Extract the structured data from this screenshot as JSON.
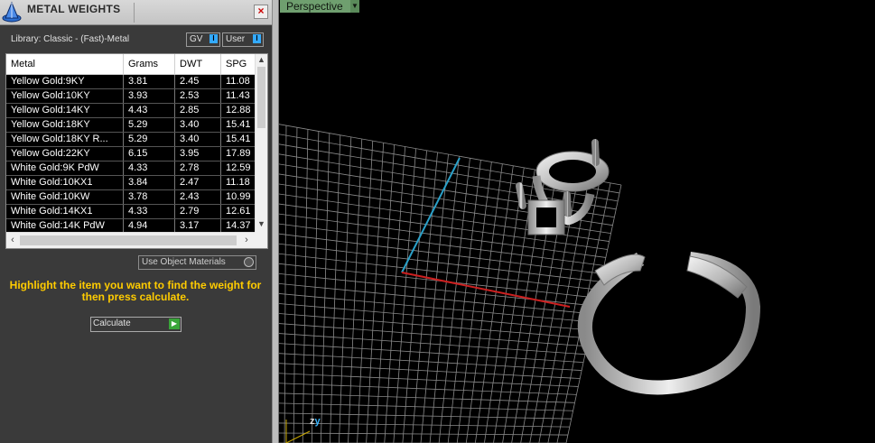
{
  "panel": {
    "title": "METAL WEIGHTS",
    "library": "Library: Classic - (Fast)-Metal",
    "toggles": {
      "gv": "GV",
      "user": "User"
    },
    "table": {
      "headers": [
        "Metal",
        "Grams",
        "DWT",
        "SPG"
      ],
      "rows": [
        [
          "Yellow Gold:9KY",
          "3.81",
          "2.45",
          "11.08"
        ],
        [
          "Yellow Gold:10KY",
          "3.93",
          "2.53",
          "11.43"
        ],
        [
          "Yellow Gold:14KY",
          "4.43",
          "2.85",
          "12.88"
        ],
        [
          "Yellow Gold:18KY",
          "5.29",
          "3.40",
          "15.41"
        ],
        [
          "Yellow Gold:18KY R...",
          "5.29",
          "3.40",
          "15.41"
        ],
        [
          "Yellow Gold:22KY",
          "6.15",
          "3.95",
          "17.89"
        ],
        [
          "White Gold:9K PdW",
          "4.33",
          "2.78",
          "12.59"
        ],
        [
          "White Gold:10KX1",
          "3.84",
          "2.47",
          "11.18"
        ],
        [
          "White Gold:10KW",
          "3.78",
          "2.43",
          "10.99"
        ],
        [
          "White Gold:14KX1",
          "4.33",
          "2.79",
          "12.61"
        ],
        [
          "White Gold:14K PdW",
          "4.94",
          "3.17",
          "14.37"
        ]
      ]
    },
    "use_object_materials": "Use Object Materials",
    "hint": "Highlight the item you want to find the weight for then press calculate.",
    "calculate": "Calculate"
  },
  "viewport": {
    "view_name": "Perspective",
    "axis_z": "z",
    "axis_y": "y",
    "colors": {
      "x_axis": "#cc2020",
      "y_axis": "#2aa0c8",
      "grid": "#8a8a8a"
    }
  }
}
